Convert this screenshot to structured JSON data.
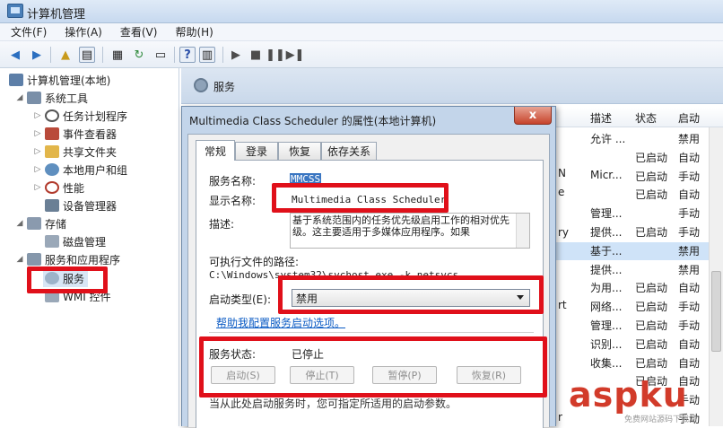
{
  "window": {
    "title": "计算机管理"
  },
  "menu": [
    "文件(F)",
    "操作(A)",
    "查看(V)",
    "帮助(H)"
  ],
  "tree": {
    "root": "计算机管理(本地)",
    "system_tools": "系统工具",
    "task_scheduler": "任务计划程序",
    "event_viewer": "事件查看器",
    "shared_folders": "共享文件夹",
    "local_users": "本地用户和组",
    "performance": "性能",
    "device_manager": "设备管理器",
    "storage": "存储",
    "disk_management": "磁盘管理",
    "services_apps": "服务和应用程序",
    "services": "服务",
    "wmi": "WMI 控件"
  },
  "right_pane": {
    "title": "服务",
    "columns": [
      "描述",
      "状态",
      "启动"
    ],
    "rows": [
      [
        "允许 ...",
        "",
        "禁用"
      ],
      [
        "",
        "已启动",
        "自动"
      ],
      [
        "Micr...",
        "已启动",
        "手动"
      ],
      [
        "",
        "已启动",
        "自动"
      ],
      [
        "管理...",
        "",
        "手动"
      ],
      [
        "提供...",
        "已启动",
        "手动"
      ],
      [
        "基于...",
        "",
        "禁用"
      ],
      [
        "提供...",
        "",
        "禁用"
      ],
      [
        "为用...",
        "已启动",
        "自动"
      ],
      [
        "网络...",
        "已启动",
        "手动"
      ],
      [
        "管理...",
        "已启动",
        "手动"
      ],
      [
        "识别...",
        "已启动",
        "自动"
      ],
      [
        "收集...",
        "已启动",
        "自动"
      ],
      [
        "",
        "已启动",
        "自动"
      ],
      [
        "",
        "",
        "手动"
      ],
      [
        "",
        "",
        "手动"
      ]
    ],
    "partial_left": [
      "N",
      "e",
      "ry",
      "rt",
      "r"
    ]
  },
  "dialog": {
    "title": "Multimedia Class Scheduler 的属性(本地计算机)",
    "close_label": "x",
    "tabs": [
      "常规",
      "登录",
      "恢复",
      "依存关系"
    ],
    "service_name_label": "服务名称:",
    "service_name_value": "MMCSS",
    "display_name_label": "显示名称:",
    "display_name_value": "Multimedia Class Scheduler",
    "description_label": "描述:",
    "description_value": "基于系统范围内的任务优先级启用工作的相对优先级。这主要适用于多媒体应用程序。如果",
    "exe_path_label": "可执行文件的路径:",
    "exe_path_value": "C:\\Windows\\system32\\svchost.exe -k netsvcs",
    "startup_type_label": "启动类型(E):",
    "startup_type_value": "禁用",
    "help_link": "帮助我配置服务启动选项。",
    "status_label": "服务状态:",
    "status_value": "已停止",
    "buttons": [
      "启动(S)",
      "停止(T)",
      "暂停(P)",
      "恢复(R)"
    ],
    "footer_text": "当从此处启动服务时，您可指定所适用的启动参数。"
  },
  "watermark": {
    "logo": "aspku",
    "sub": "免费网站源码下载站"
  },
  "colors": {
    "highlight": "#e0101a",
    "selection": "#3a76c2",
    "link": "#0b5bc4"
  }
}
